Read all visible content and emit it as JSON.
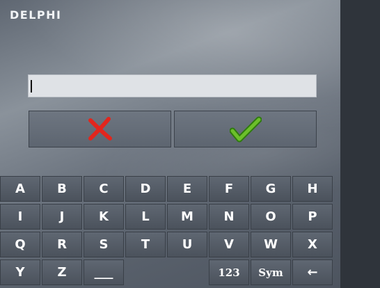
{
  "app": {
    "brand": "DELPHI"
  },
  "input": {
    "value": "",
    "placeholder": ""
  },
  "actions": {
    "cancel_icon": "x-icon",
    "ok_icon": "check-icon"
  },
  "colors": {
    "cancel": "#e2261d",
    "ok": "#4fa81b"
  },
  "keyboard": {
    "rows": [
      [
        "A",
        "B",
        "C",
        "D",
        "E",
        "F",
        "G",
        "H"
      ],
      [
        "I",
        "J",
        "K",
        "L",
        "M",
        "N",
        "O",
        "P"
      ],
      [
        "Q",
        "R",
        "S",
        "T",
        "U",
        "V",
        "W",
        "X"
      ],
      [
        "Y",
        "Z",
        "space",
        "",
        "",
        "123",
        "Sym",
        "backspace"
      ]
    ],
    "row4": {
      "y": "Y",
      "z": "Z",
      "space_glyph": "___",
      "num": "123",
      "sym": "Sym",
      "back_glyph": "←"
    }
  }
}
